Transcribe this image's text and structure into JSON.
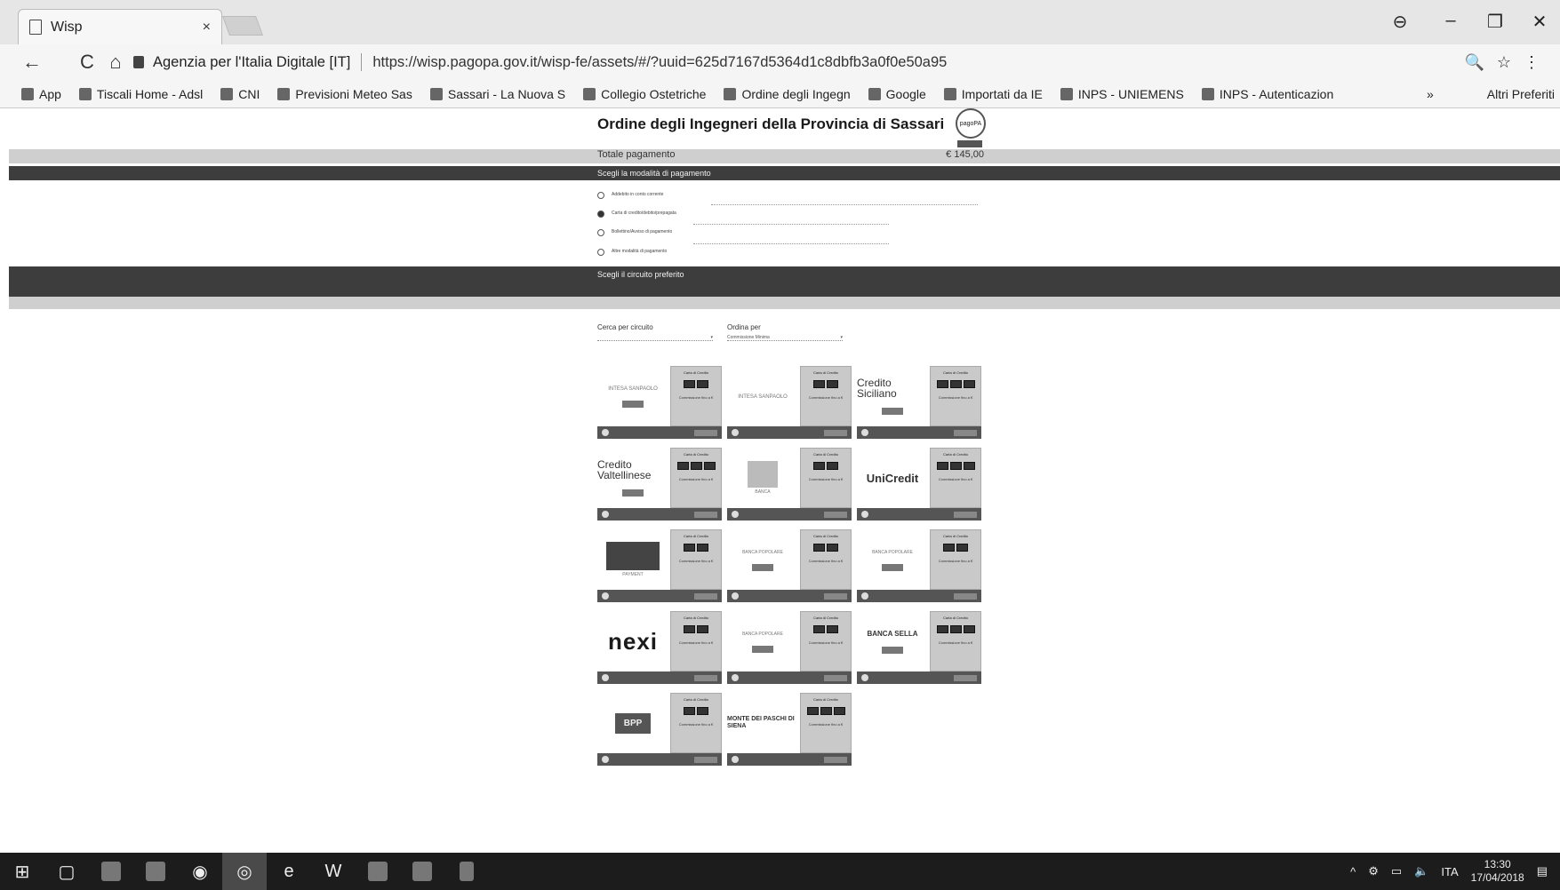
{
  "browser": {
    "tab_title": "Wisp",
    "tab_close": "×",
    "window_controls": {
      "account": "⊖",
      "minimize": "–",
      "maximize": "❐",
      "close": "✕"
    },
    "nav": {
      "back": "←",
      "reload": "C",
      "home": "⌂"
    },
    "secure_label": "Agenzia per l'Italia Digitale [IT]",
    "url": "https://wisp.pagopa.gov.it/wisp-fe/assets/#/?uuid=625d7167d5364d1c8dbfb3a0f0e50a95",
    "omni_icons": {
      "zoom": "🔍",
      "star": "☆",
      "menu": "⋮"
    },
    "bookmarks": [
      {
        "label": "App",
        "icon": "apps-grid-icon"
      },
      {
        "label": "Tiscali Home - Adsl",
        "icon": "globe-icon"
      },
      {
        "label": "CNI",
        "icon": "bookmark-icon"
      },
      {
        "label": "Previsioni Meteo Sas",
        "icon": "weather-icon"
      },
      {
        "label": "Sassari - La Nuova S",
        "icon": "news-icon"
      },
      {
        "label": "Collegio Ostetriche",
        "icon": "bookmark-icon"
      },
      {
        "label": "Ordine degli Ingegn",
        "icon": "bookmark-icon"
      },
      {
        "label": "Google",
        "icon": "google-icon"
      },
      {
        "label": "Importati da IE",
        "icon": "folder-icon"
      },
      {
        "label": "INPS - UNIEMENS",
        "icon": "inps-icon"
      },
      {
        "label": "INPS - Autenticazion",
        "icon": "inps-icon"
      }
    ],
    "bookmarks_more": "»",
    "bookmarks_other": "Altri Preferiti"
  },
  "page": {
    "org_title": "Ordine degli Ingegneri della Provincia di Sassari",
    "logo_text": "pagoPA",
    "total_label": "Totale pagamento",
    "total_value": "€ 145,00",
    "section_payment_method": "Scegli la modalità di pagamento",
    "methods": [
      {
        "label": "Addebito in conto corrente",
        "selected": false
      },
      {
        "label": "Carta di credito/debito/prepagata",
        "selected": true
      },
      {
        "label": "Bollettino/Avviso di pagamento",
        "selected": false
      },
      {
        "label": "Altre modalità di pagamento",
        "selected": false
      }
    ],
    "section_circuit": "Scegli il circuito preferito",
    "filter_search_label": "Cerca per circuito",
    "filter_order_label": "Ordina per",
    "filter_order_value": "Commissione Minima",
    "card_title": "Carta di Credito",
    "card_fee": "Commissione fino a €",
    "providers": [
      {
        "name": "INTESA SANPAOLO",
        "style": "text"
      },
      {
        "name": "INTESA SANPAOLO",
        "style": "text"
      },
      {
        "name": "Credito Siciliano",
        "style": "ccl"
      },
      {
        "name": "Credito Valtellinese",
        "style": "ccl"
      },
      {
        "name": "BANCA",
        "style": "img"
      },
      {
        "name": "UniCredit",
        "style": "uc"
      },
      {
        "name": "PAYMENT",
        "style": "imgdark"
      },
      {
        "name": "BANCA POPOLARE",
        "style": "text"
      },
      {
        "name": "BANCA POPOLARE",
        "style": "text"
      },
      {
        "name": "nexi",
        "style": "big"
      },
      {
        "name": "BANCA POPOLARE",
        "style": "text"
      },
      {
        "name": "BANCA SELLA",
        "style": "text"
      },
      {
        "name": "BPP",
        "style": "imgdark"
      },
      {
        "name": "MONTE DEI PASCHI DI SIENA",
        "style": "mps"
      }
    ]
  },
  "taskbar": {
    "lang": "ITA",
    "time": "13:30",
    "date": "17/04/2018"
  }
}
